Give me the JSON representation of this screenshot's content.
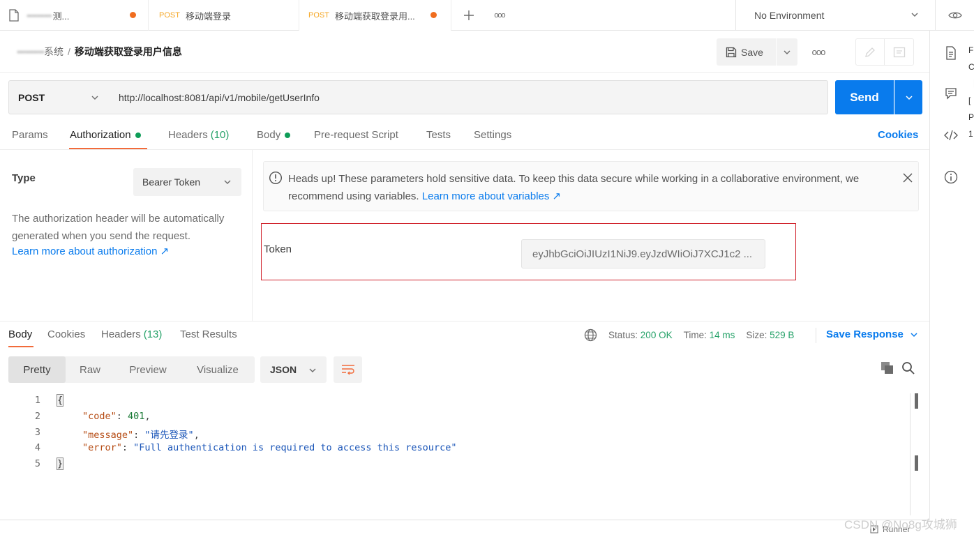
{
  "tabs": [
    {
      "method": "",
      "title": "测...",
      "blurred_prefix": "••••••••••",
      "unsaved": true
    },
    {
      "method": "POST",
      "title": "移动端登录",
      "unsaved": false
    },
    {
      "method": "POST",
      "title": "移动端获取登录用...",
      "unsaved": true,
      "active": true
    }
  ],
  "environment": {
    "label": "No Environment"
  },
  "breadcrumb": {
    "blurred": "••••••••••",
    "parent": "系统",
    "separator": "/",
    "current": "移动端获取登录用户信息"
  },
  "toolbar": {
    "save_label": "Save",
    "more_label": "ooo"
  },
  "request": {
    "method": "POST",
    "url": "http://localhost:8081/api/v1/mobile/getUserInfo",
    "send_label": "Send"
  },
  "request_tabs": {
    "params": "Params",
    "authorization": "Authorization",
    "headers": "Headers",
    "headers_count": "(10)",
    "body": "Body",
    "prerequest": "Pre-request Script",
    "tests": "Tests",
    "settings": "Settings",
    "cookies": "Cookies"
  },
  "auth": {
    "type_label": "Type",
    "type_value": "Bearer Token",
    "description": "The authorization header will be automatically generated when you send the request.",
    "learn_more": "Learn more about authorization ↗",
    "notice_text": "Heads up! These parameters hold sensitive data. To keep this data secure while working in a collaborative environment, we recommend using variables.",
    "notice_link": "Learn more about variables ↗",
    "token_label": "Token",
    "token_value": "eyJhbGciOiJIUzI1NiJ9.eyJzdWIiOiJ7XCJ1c2 ..."
  },
  "response_tabs": {
    "body": "Body",
    "cookies": "Cookies",
    "headers": "Headers",
    "headers_count": "(13)",
    "test_results": "Test Results"
  },
  "response_status": {
    "status_label": "Status:",
    "status_value": "200 OK",
    "time_label": "Time:",
    "time_value": "14 ms",
    "size_label": "Size:",
    "size_value": "529 B",
    "save_response": "Save Response"
  },
  "response_view": {
    "pretty": "Pretty",
    "raw": "Raw",
    "preview": "Preview",
    "visualize": "Visualize",
    "format": "JSON"
  },
  "response_body": {
    "lines": [
      "1",
      "2",
      "3",
      "4",
      "5"
    ],
    "open_brace": "{",
    "close_brace": "}",
    "code_key": "\"code\"",
    "code_value": "401",
    "message_key": "\"message\"",
    "message_value": "\"请先登录\"",
    "error_key": "\"error\"",
    "error_value": "\"Full authentication is required to access this resource\""
  },
  "footer": {
    "runner": "Runner",
    "watermark": "CSDN @No8g攻城狮"
  },
  "sidebar_edge": [
    "F",
    "C",
    "【",
    "[",
    "P",
    "1"
  ],
  "colors": {
    "accent": "#097bed",
    "method_post": "#f5a623",
    "unsaved_dot": "#f06d1f",
    "status_ok": "#26a269",
    "highlight_box": "#d0202a",
    "tab_underline": "#f26b3a"
  }
}
